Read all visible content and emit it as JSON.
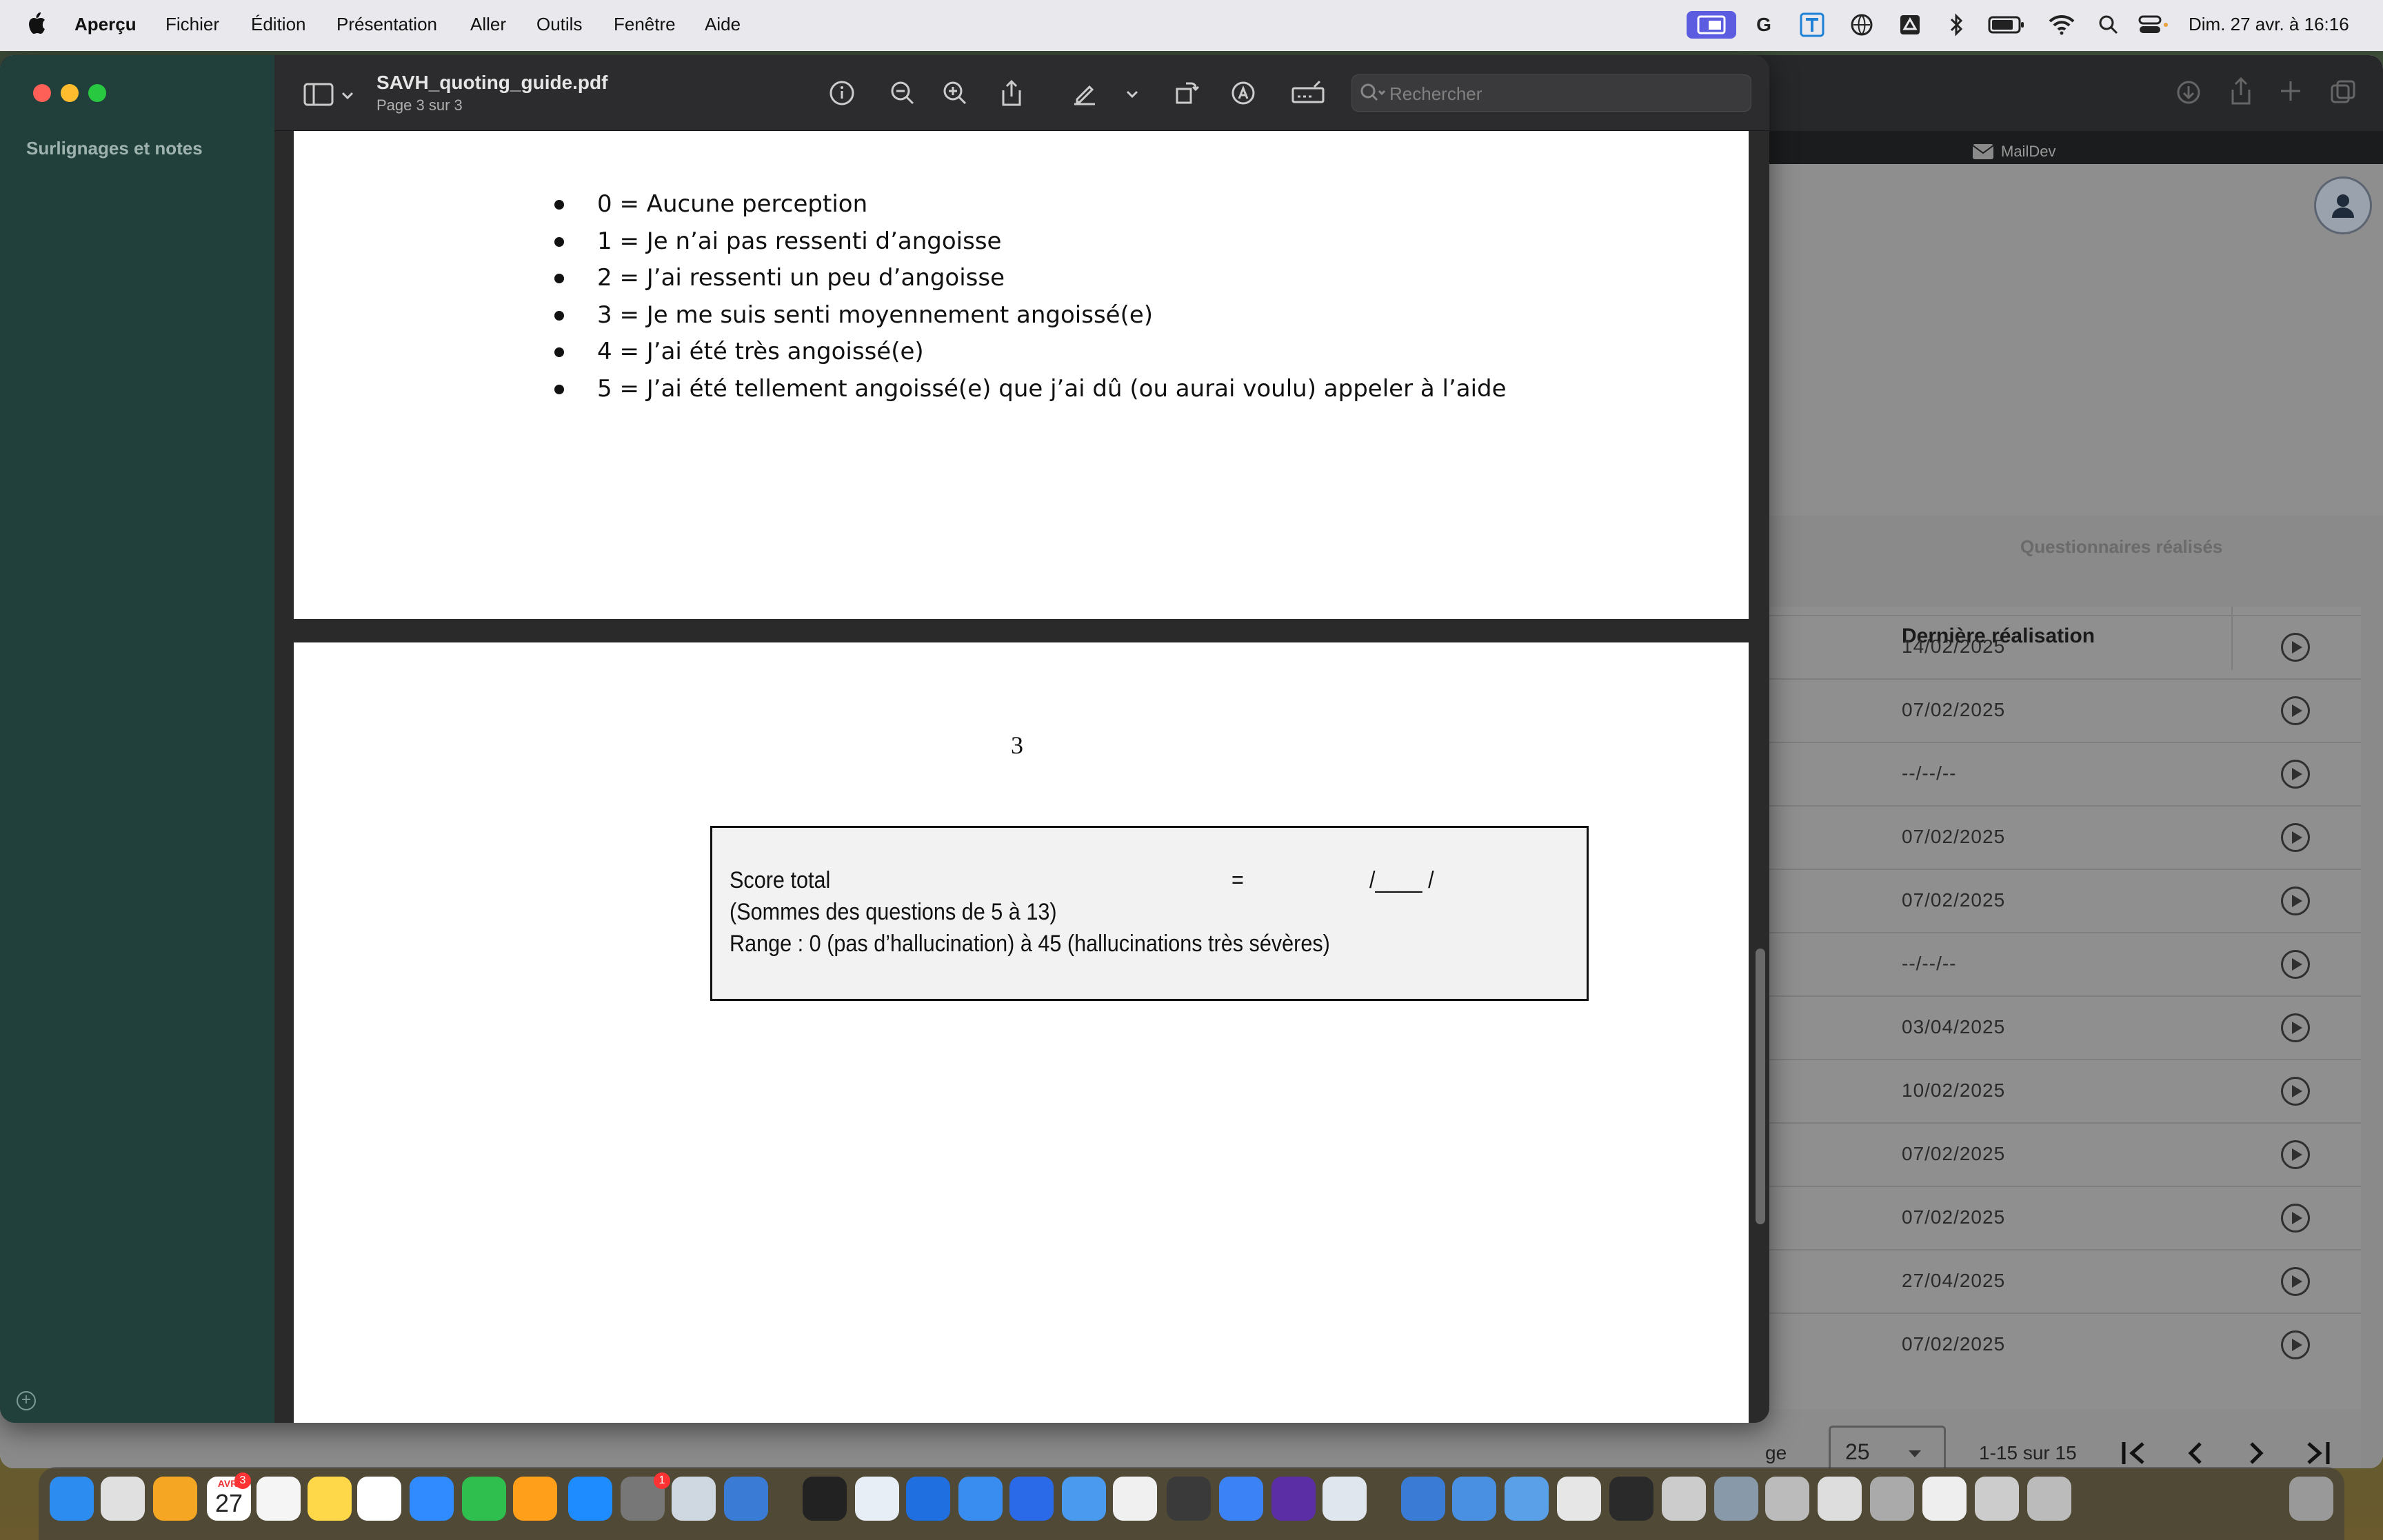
{
  "menubar": {
    "app_name": "Aperçu",
    "items": [
      "Fichier",
      "Édition",
      "Présentation",
      "Aller",
      "Outils",
      "Fenêtre",
      "Aide"
    ],
    "clock": "Dim. 27 avr. à 16:16"
  },
  "preview": {
    "sidebar_title": "Surlignages et notes",
    "document_title": "SAVH_quoting_guide.pdf",
    "page_indicator": "Page 3 sur 3",
    "search_placeholder": "Rechercher",
    "bullets": [
      "0 = Aucune perception",
      "1 = Je n’ai pas ressenti d’angoisse",
      "2 = J’ai ressenti un peu d’angoisse",
      "3 = Je me suis senti moyennement angoissé(e)",
      "4 = J’ai été très angoissé(e)",
      "5 = J’ai été tellement angoissé(e) que j’ai dû (ou aurai voulu) appeler à l’aide"
    ],
    "page_number": "3",
    "score": {
      "label": "Score total",
      "equals": "=",
      "blank": "/____ /",
      "line2": "(Sommes des questions de 5 à 13)",
      "line3": "Range : 0 (pas d’hallucination) à 45 (hallucinations très sévères)"
    }
  },
  "background_app": {
    "tab_label": "MailDev",
    "section_tab": "Questionnaires réalisés",
    "column_header": "Dernière réalisation",
    "dates": [
      "14/02/2025",
      "07/02/2025",
      "--/--/--",
      "07/02/2025",
      "07/02/2025",
      "--/--/--",
      "03/04/2025",
      "10/02/2025",
      "07/02/2025",
      "07/02/2025",
      "27/04/2025",
      "07/02/2025"
    ],
    "pagination": {
      "label_fragment": "ge",
      "page_size": "25",
      "range": "1-15 sur 15"
    }
  },
  "dock": {
    "calendar_month": "AVR.",
    "calendar_day": "27",
    "badge_calendar": "3",
    "badge_settings": "1"
  }
}
